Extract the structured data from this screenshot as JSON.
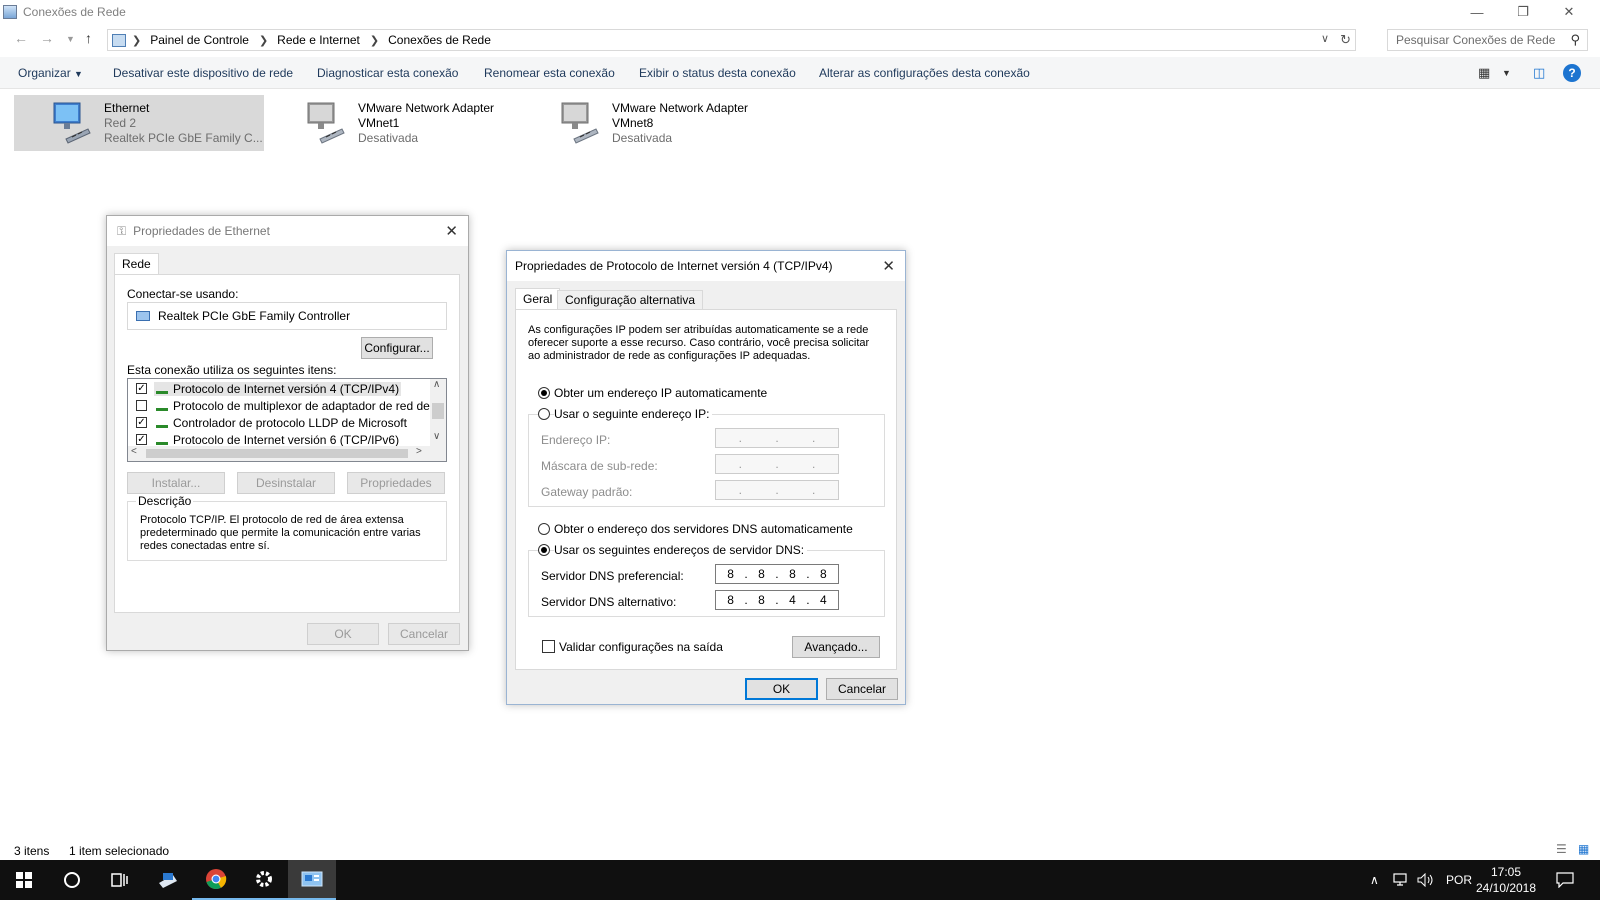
{
  "window": {
    "title": "Conexões de Rede",
    "minimize_icon": "minimize-icon",
    "restore_icon": "restore-icon",
    "close_icon": "close-icon"
  },
  "address": {
    "crumbs": [
      "Painel de Controle",
      "Rede e Internet",
      "Conexões de Rede"
    ],
    "search_placeholder": "Pesquisar Conexões de Rede"
  },
  "toolbar": {
    "organize": "Organizar",
    "disable": "Desativar este dispositivo de rede",
    "diagnose": "Diagnosticar esta conexão",
    "rename": "Renomear esta conexão",
    "status": "Exibir o status desta conexão",
    "change": "Alterar as configurações desta conexão"
  },
  "adapters": [
    {
      "name": "Ethernet",
      "network": "Red 2",
      "device": "Realtek PCIe GbE Family C...",
      "selected": true
    },
    {
      "name": "VMware Network Adapter",
      "network": "VMnet1",
      "device": "Desativada",
      "selected": false
    },
    {
      "name": "VMware Network Adapter",
      "network": "VMnet8",
      "device": "Desativada",
      "selected": false
    }
  ],
  "eth_dialog": {
    "title": "Propriedades de Ethernet",
    "tab": "Rede",
    "connect_using": "Conectar-se usando:",
    "adapter": "Realtek PCIe GbE Family Controller",
    "configure": "Configurar...",
    "items_label": "Esta conexão utiliza os seguintes itens:",
    "items": [
      {
        "label": "Protocolo de Internet versión 4 (TCP/IPv4)",
        "checked": true
      },
      {
        "label": "Protocolo de multiplexor de adaptador de red de Micros",
        "checked": false
      },
      {
        "label": "Controlador de protocolo LLDP de Microsoft",
        "checked": true
      },
      {
        "label": "Protocolo de Internet versión 6 (TCP/IPv6)",
        "checked": true
      }
    ],
    "install": "Instalar...",
    "uninstall": "Desinstalar",
    "properties": "Propriedades",
    "description_label": "Descrição",
    "description": "Protocolo TCP/IP. El protocolo de red de área extensa predeterminado que permite la comunicación entre varias redes conectadas entre sí.",
    "ok": "OK",
    "cancel": "Cancelar"
  },
  "ipv4_dialog": {
    "title": "Propriedades de Protocolo de Internet versión 4 (TCP/IPv4)",
    "tab_general": "Geral",
    "tab_alt": "Configuração alternativa",
    "intro": "As configurações IP podem ser atribuídas automaticamente se a rede oferecer suporte a esse recurso. Caso contrário, você precisa solicitar ao administrador de rede as configurações IP adequadas.",
    "auto_ip": "Obter um endereço IP automaticamente",
    "manual_ip": "Usar o seguinte endereço IP:",
    "ip_label": "Endereço IP:",
    "mask_label": "Máscara de sub-rede:",
    "gateway_label": "Gateway padrão:",
    "auto_dns": "Obter o endereço dos servidores DNS automaticamente",
    "manual_dns": "Usar os seguintes endereços de servidor DNS:",
    "dns1_label": "Servidor DNS preferencial:",
    "dns1": [
      "8",
      "8",
      "8",
      "8"
    ],
    "dns2_label": "Servidor DNS alternativo:",
    "dns2": [
      "8",
      "8",
      "4",
      "4"
    ],
    "validate": "Validar configurações na saída",
    "advanced": "Avançado...",
    "ok": "OK",
    "cancel": "Cancelar"
  },
  "statusbar": {
    "count": "3 itens",
    "selected": "1 item selecionado"
  },
  "taskbar": {
    "lang": "POR",
    "time": "17:05",
    "date": "24/10/2018"
  }
}
